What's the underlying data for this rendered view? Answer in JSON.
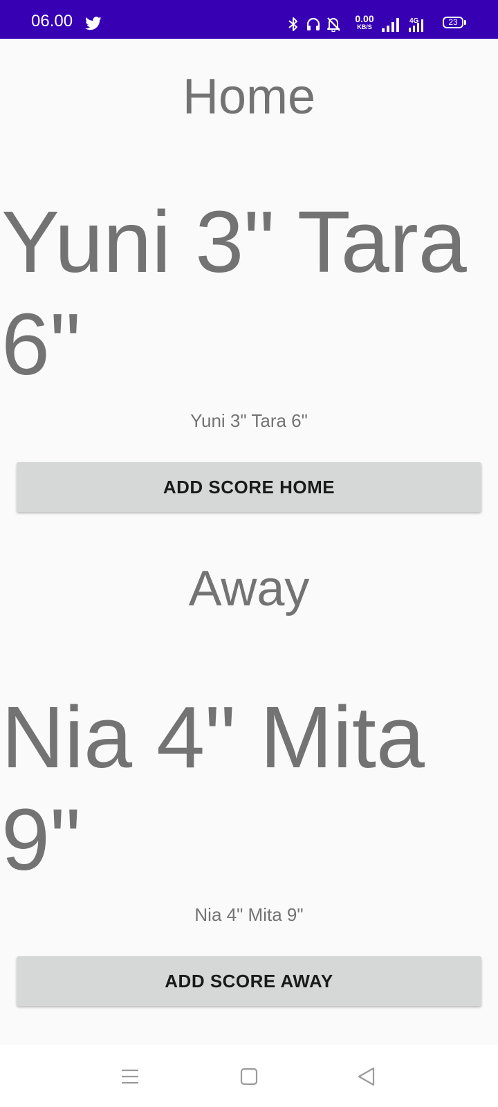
{
  "status_bar": {
    "time": "06.00",
    "network_speed": "0.00",
    "network_speed_unit": "KB/S",
    "network_type": "4G",
    "battery_level": "23",
    "background_color": "#3700b3",
    "icons": [
      "twitter-icon",
      "bluetooth-icon",
      "headphones-icon",
      "bell-off-icon",
      "signal-icon",
      "signal-4g-icon",
      "battery-icon"
    ]
  },
  "home": {
    "title": "Home",
    "score_large": "Yuni 3\" Tara 6\"",
    "score_small": "Yuni 3\" Tara 6\"",
    "button_label": "ADD SCORE HOME"
  },
  "away": {
    "title": "Away",
    "score_large": "Nia 4\" Mita 9\"",
    "score_small": "Nia 4\" Mita 9\"",
    "button_label": "ADD SCORE AWAY"
  },
  "nav_bar": {
    "icons": [
      "menu-icon",
      "home-square-icon",
      "back-triangle-icon"
    ]
  },
  "colors": {
    "text_gray": "#737373",
    "button_bg": "#d6d7d7",
    "page_bg": "#fafafa"
  }
}
